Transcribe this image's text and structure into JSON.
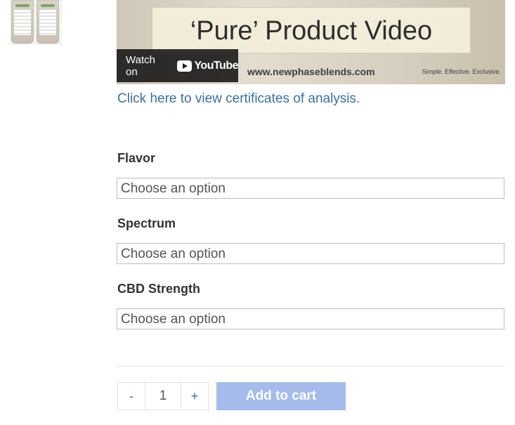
{
  "video": {
    "title": "‘Pure’ Product Video",
    "url": "www.newphaseblends.com",
    "tagline": "Simple. Effective. Exclusive.",
    "watch_on": "Watch on",
    "youtube_word": "YouTube"
  },
  "cert_link": "Click here to view certificates of analysis.",
  "variations": [
    {
      "label": "Flavor",
      "placeholder": "Choose an option"
    },
    {
      "label": "Spectrum",
      "placeholder": "Choose an option"
    },
    {
      "label": "CBD Strength",
      "placeholder": "Choose an option"
    }
  ],
  "cart": {
    "decrement": "-",
    "quantity": "1",
    "increment": "+",
    "add_to_cart": "Add to cart",
    "button_color": "#a5bbeb"
  },
  "colors": {
    "link": "#3a6ea5"
  }
}
